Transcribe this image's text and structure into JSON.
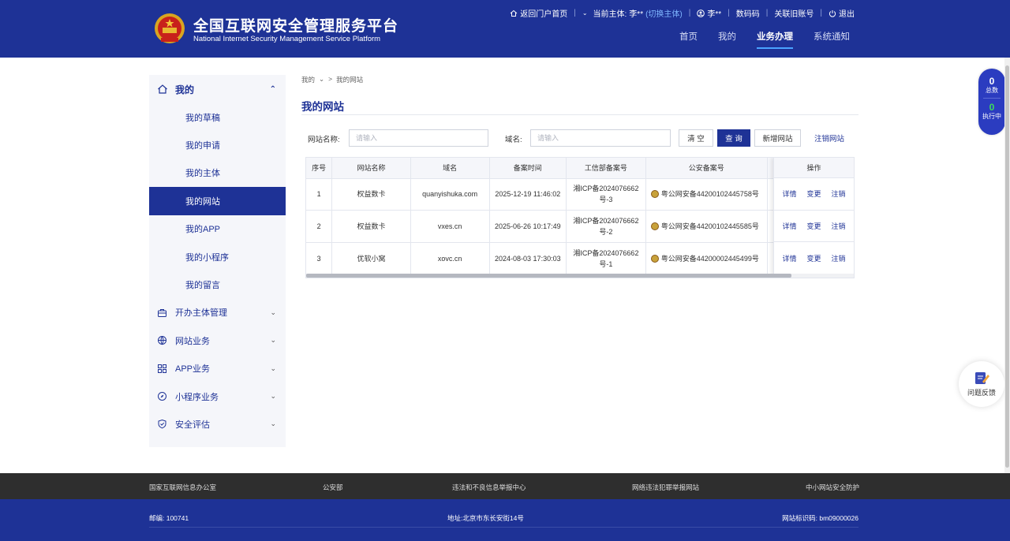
{
  "header": {
    "title_cn": "全国互联网安全管理服务平台",
    "title_en": "National Internet Security Management Service Platform",
    "topbar": {
      "return_portal": "返回门户首页",
      "current_entity_label": "当前主体:",
      "current_entity_value": "李**",
      "switch_entity": "(切换主体)",
      "user": "李**",
      "digital_code": "数码码",
      "linked_account": "关联旧账号",
      "logout": "退出"
    },
    "nav": [
      "首页",
      "我的",
      "业务办理",
      "系统通知"
    ],
    "nav_active_index": 2
  },
  "sidebar": {
    "section_title": "我的",
    "sub_items": [
      "我的草稿",
      "我的申请",
      "我的主体",
      "我的网站",
      "我的APP",
      "我的小程序",
      "我的留言"
    ],
    "active_sub_index": 3,
    "groups": [
      {
        "label": "开办主体管理",
        "icon": "briefcase-icon"
      },
      {
        "label": "网站业务",
        "icon": "globe-icon"
      },
      {
        "label": "APP业务",
        "icon": "grid-icon"
      },
      {
        "label": "小程序业务",
        "icon": "compass-icon"
      },
      {
        "label": "安全评估",
        "icon": "shield-icon"
      }
    ]
  },
  "breadcrumb": {
    "root": "我的",
    "sep": ">",
    "current": "我的网站"
  },
  "page_title": "我的网站",
  "filters": {
    "name_label": "网站名称:",
    "name_placeholder": "请输入",
    "domain_label": "域名:",
    "domain_placeholder": "请输入",
    "clear": "清 空",
    "query": "查 询",
    "add": "新增网站",
    "cancel_site": "注销网站"
  },
  "table": {
    "headers": [
      "序号",
      "网站名称",
      "域名",
      "备案时间",
      "工信部备案号",
      "公安备案号",
      "操作"
    ],
    "rows": [
      {
        "no": "1",
        "name": "权益数卡",
        "domain": "quanyishuka.com",
        "time": "2025-12-19 11:46:02",
        "icp": "湘ICP备2024076662号-3",
        "psb": "粤公网安备44200102445758号"
      },
      {
        "no": "2",
        "name": "权益数卡",
        "domain": "vxes.cn",
        "time": "2025-06-26 10:17:49",
        "icp": "湘ICP备2024076662号-2",
        "psb": "粤公网安备44200102445585号"
      },
      {
        "no": "3",
        "name": "优软小窝",
        "domain": "xovc.cn",
        "time": "2024-08-03 17:30:03",
        "icp": "湘ICP备2024076662号-1",
        "psb": "粤公网安备44200002445499号"
      }
    ],
    "ops": [
      "详情",
      "变更",
      "注销"
    ]
  },
  "counter": {
    "total": "0",
    "total_label": "总数",
    "running": "0",
    "running_label": "执行中"
  },
  "feedback": "问题反馈",
  "footer": {
    "links": [
      "国家互联网信息办公室",
      "公安部",
      "违法和不良信息举报中心",
      "网络违法犯罪举报网站",
      "中小网站安全防护"
    ],
    "postcode": "邮编:  100741",
    "address": "地址:北京市东长安街14号",
    "site_id": "网站标识码:  bm09000026"
  },
  "colors": {
    "primary": "#1e3296",
    "accent": "#4aa3ff",
    "footer_dark": "#2e2e2e"
  }
}
